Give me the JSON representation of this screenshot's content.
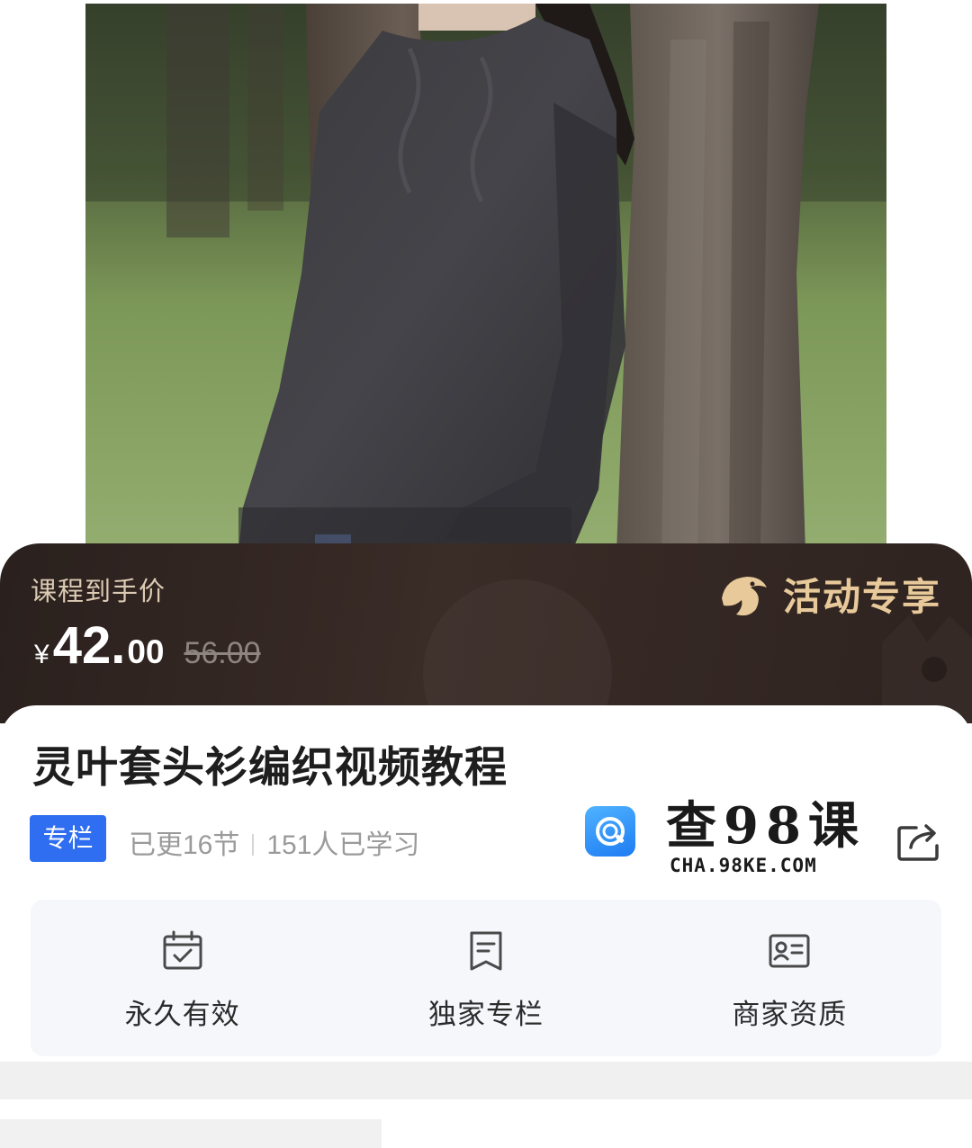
{
  "price_banner": {
    "label": "课程到手价",
    "currency": "¥",
    "price_int": "42.",
    "price_dec": "00",
    "original_price": "56.00",
    "promo": "活动专享"
  },
  "course": {
    "title": "灵叶套头衫编织视频教程",
    "tag": "专栏",
    "updated": "已更16节",
    "learners": "151人已学习"
  },
  "watermark": {
    "cn": "查98课",
    "en": "CHA.98KE.COM"
  },
  "features": [
    {
      "label": "永久有效",
      "icon": "calendar-check-icon"
    },
    {
      "label": "独家专栏",
      "icon": "bookmark-icon"
    },
    {
      "label": "商家资质",
      "icon": "id-card-icon"
    }
  ],
  "colors": {
    "accent": "#2f6ef0",
    "banner_bg": "#2e2320",
    "promo_gold": "#e8c99a"
  }
}
